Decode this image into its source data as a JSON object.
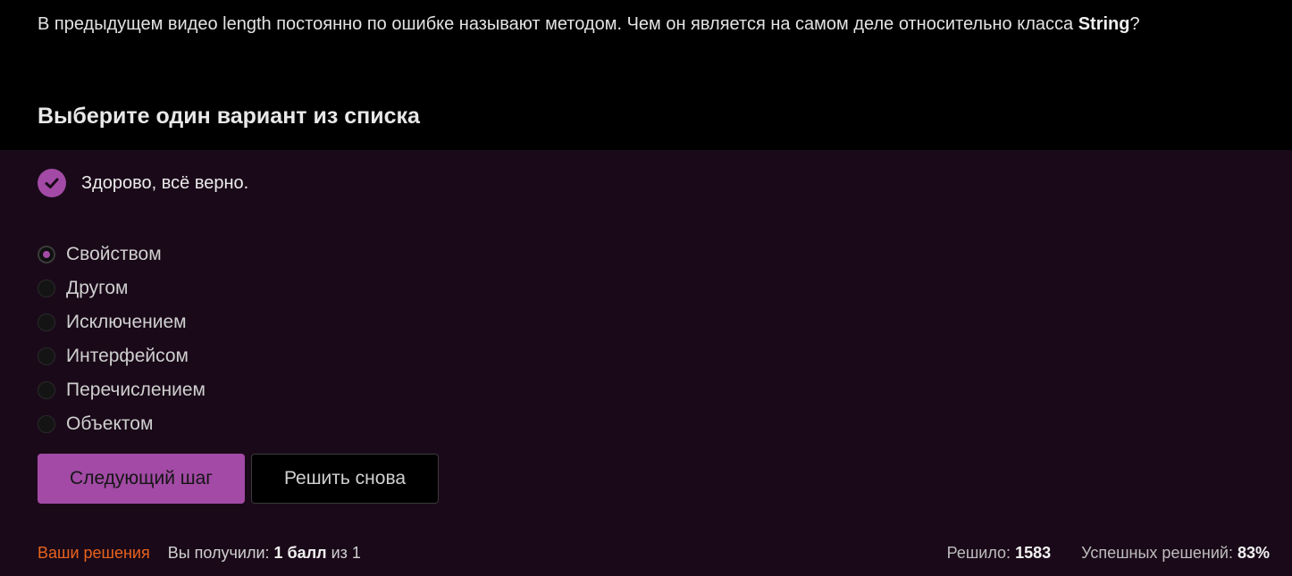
{
  "question": {
    "text": "В предыдущем видео length постоянно по ошибке называют методом. Чем он является на самом деле относительно класса ",
    "bold_term": "String",
    "suffix": "?"
  },
  "instruction": "Выберите один вариант из списка",
  "feedback": {
    "text": "Здорово, всё верно.",
    "icon": "check-icon",
    "accent_color": "#a24aa5"
  },
  "options": [
    {
      "label": "Свойством",
      "selected": true
    },
    {
      "label": "Другом",
      "selected": false
    },
    {
      "label": "Исключением",
      "selected": false
    },
    {
      "label": "Интерфейсом",
      "selected": false
    },
    {
      "label": "Перечислением",
      "selected": false
    },
    {
      "label": "Объектом",
      "selected": false
    }
  ],
  "buttons": {
    "next_label": "Следующий шаг",
    "retry_label": "Решить снова"
  },
  "footer": {
    "solutions_link": "Ваши решения",
    "score_prefix": "Вы получили: ",
    "score_value": "1 балл",
    "score_suffix": " из 1",
    "solved_label": "Решило: ",
    "solved_value": "1583",
    "success_label": "Успешных решений: ",
    "success_value": "83%"
  }
}
